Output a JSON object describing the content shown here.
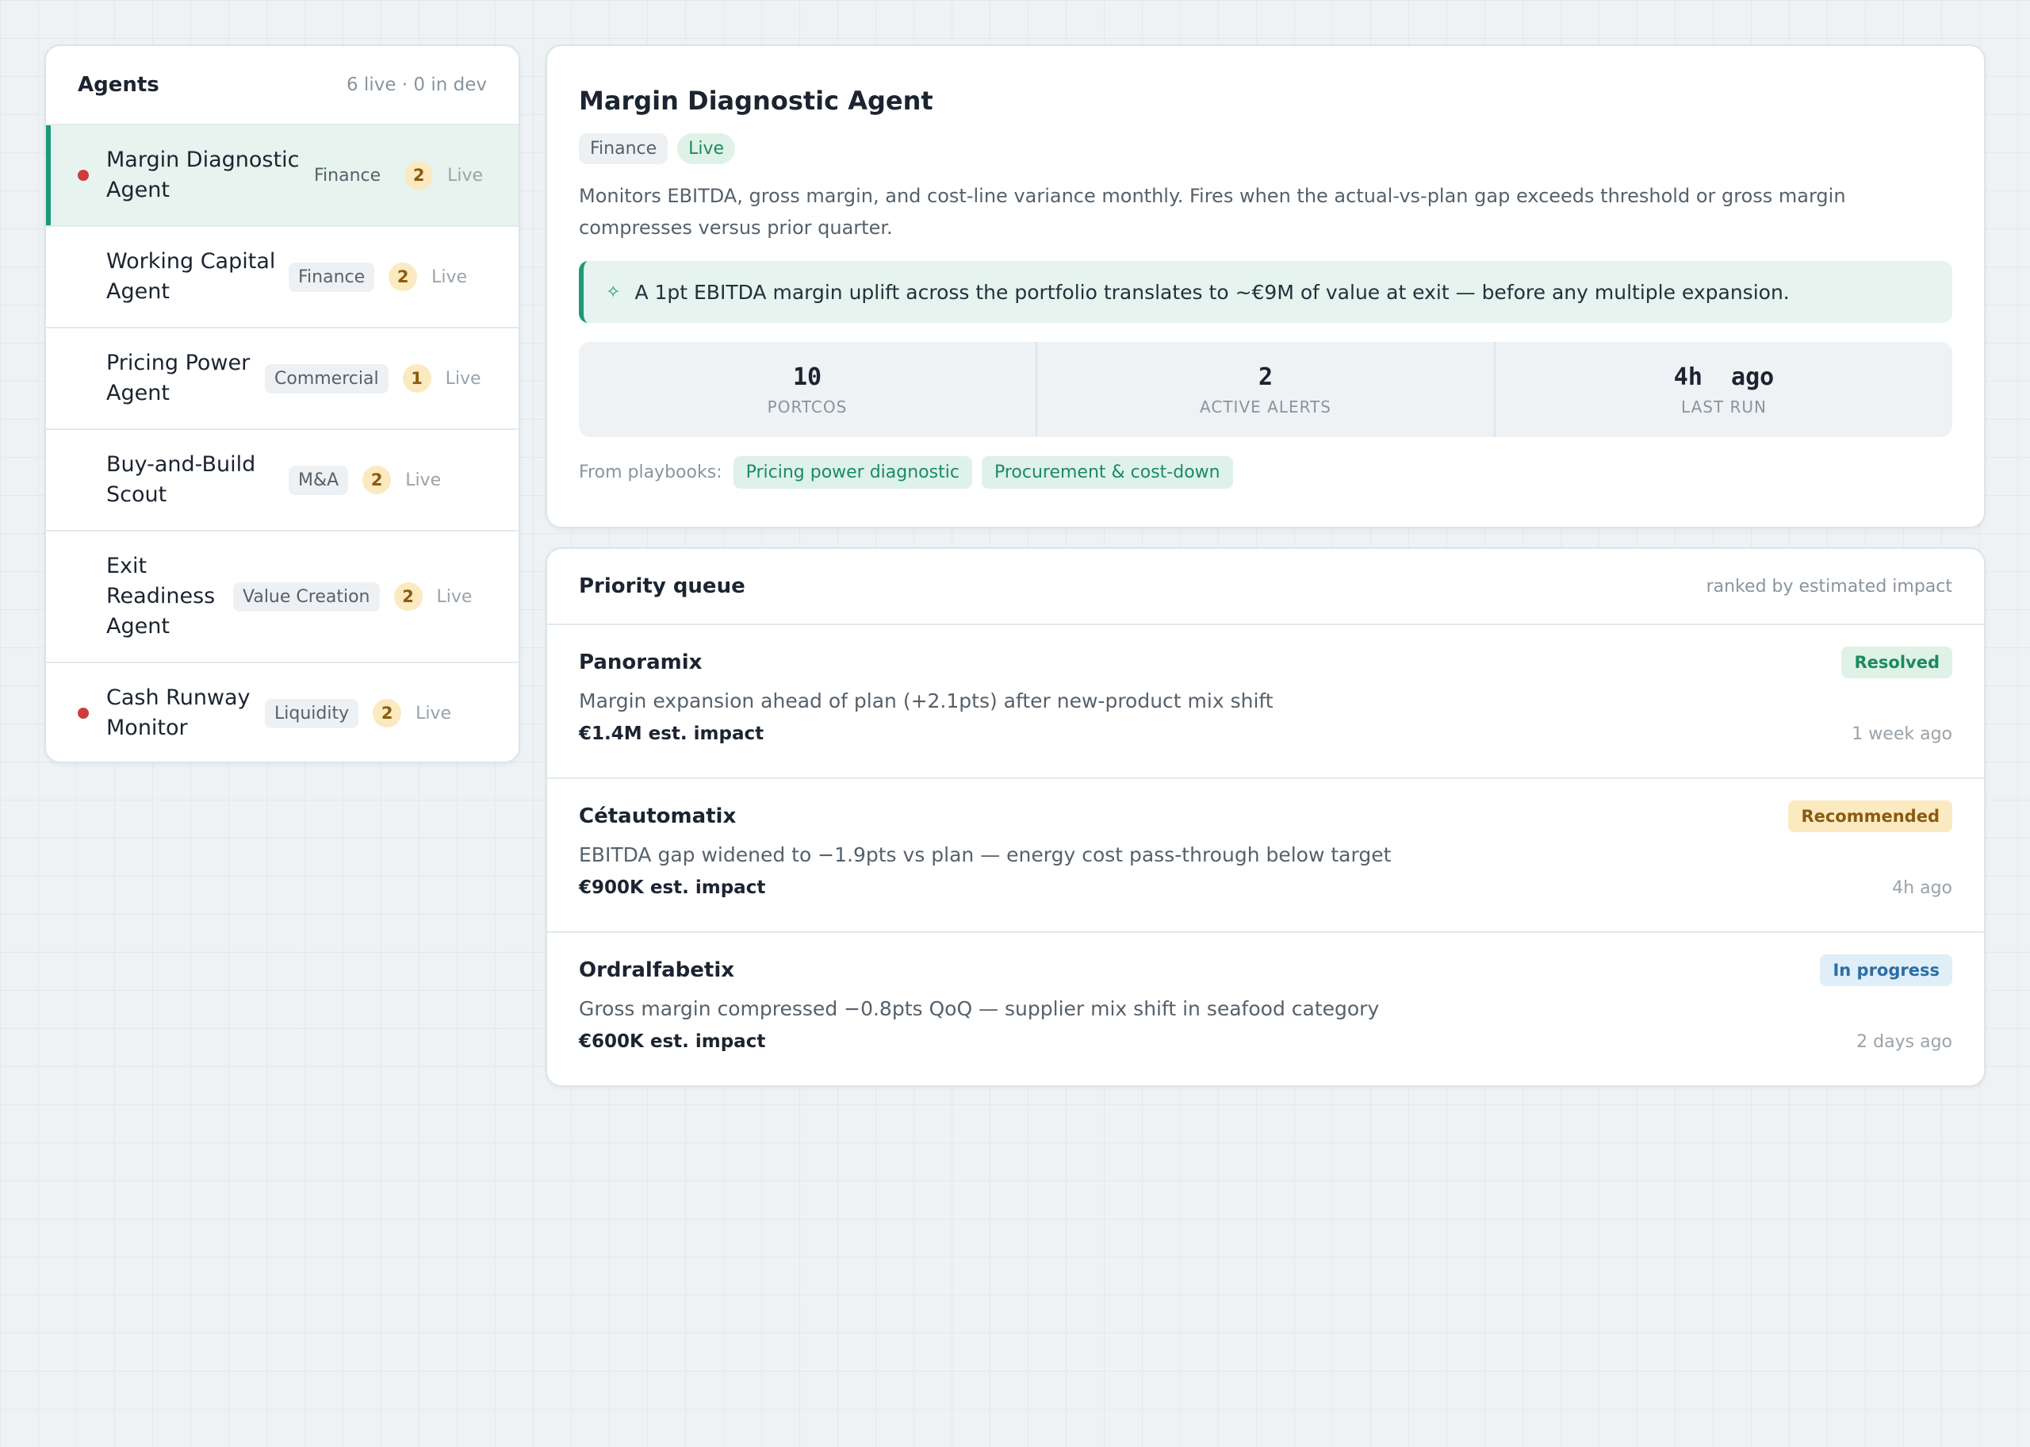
{
  "agents_panel": {
    "title": "Agents",
    "meta": "6 live · 0 in dev",
    "items": [
      {
        "name": "Margin Diagnostic Agent",
        "category": "Finance",
        "count": "2",
        "status": "Live",
        "alert_dot": true,
        "selected": true
      },
      {
        "name": "Working Capital Agent",
        "category": "Finance",
        "count": "2",
        "status": "Live",
        "alert_dot": false,
        "selected": false
      },
      {
        "name": "Pricing Power Agent",
        "category": "Commercial",
        "count": "1",
        "status": "Live",
        "alert_dot": false,
        "selected": false
      },
      {
        "name": "Buy-and-Build Scout",
        "category": "M&A",
        "count": "2",
        "status": "Live",
        "alert_dot": false,
        "selected": false
      },
      {
        "name": "Exit Readiness Agent",
        "category": "Value Creation",
        "count": "2",
        "status": "Live",
        "alert_dot": false,
        "selected": false
      },
      {
        "name": "Cash Runway Monitor",
        "category": "Liquidity",
        "count": "2",
        "status": "Live",
        "alert_dot": true,
        "selected": false
      }
    ]
  },
  "detail": {
    "title": "Margin Diagnostic Agent",
    "category": "Finance",
    "status": "Live",
    "description": "Monitors EBITDA, gross margin, and cost-line variance monthly. Fires when the actual-vs-plan gap exceeds threshold or gross margin compresses versus prior quarter.",
    "insight": "A 1pt EBITDA margin uplift across the portfolio translates to ~€9M of value at exit — before any multiple expansion.",
    "insight_icon": "sparkle-icon",
    "stats": [
      {
        "value": "10",
        "label": "PORTCOS"
      },
      {
        "value": "2",
        "label": "ACTIVE ALERTS"
      },
      {
        "value": "4h  ago",
        "label": "LAST RUN"
      }
    ],
    "playbooks_label": "From playbooks:",
    "playbooks": [
      "Pricing power diagnostic",
      "Procurement & cost-down"
    ]
  },
  "queue": {
    "title": "Priority queue",
    "meta": "ranked by estimated impact",
    "items": [
      {
        "company": "Panoramix",
        "badge": "Resolved",
        "description": "Margin expansion ahead of plan (+2.1pts) after new-product mix shift",
        "impact": "€1.4M est. impact",
        "time": "1 week ago"
      },
      {
        "company": "Cétautomatix",
        "badge": "Recommended",
        "description": "EBITDA gap widened to −1.9pts vs plan — energy cost pass-through below target",
        "impact": "€900K est. impact",
        "time": "4h ago"
      },
      {
        "company": "Ordralfabetix",
        "badge": "In progress",
        "description": "Gross margin compressed −0.8pts QoQ — supplier mix shift in seafood category",
        "impact": "€600K est. impact",
        "time": "2 days ago"
      }
    ]
  },
  "colors": {
    "accent": "#1a9a76",
    "alert_dot": "#cf3c3c",
    "count_badge": "#fbe9c0",
    "resolved": "#1b8b5d",
    "recommended": "#8a5b0f",
    "in_progress": "#2b6ea3"
  }
}
